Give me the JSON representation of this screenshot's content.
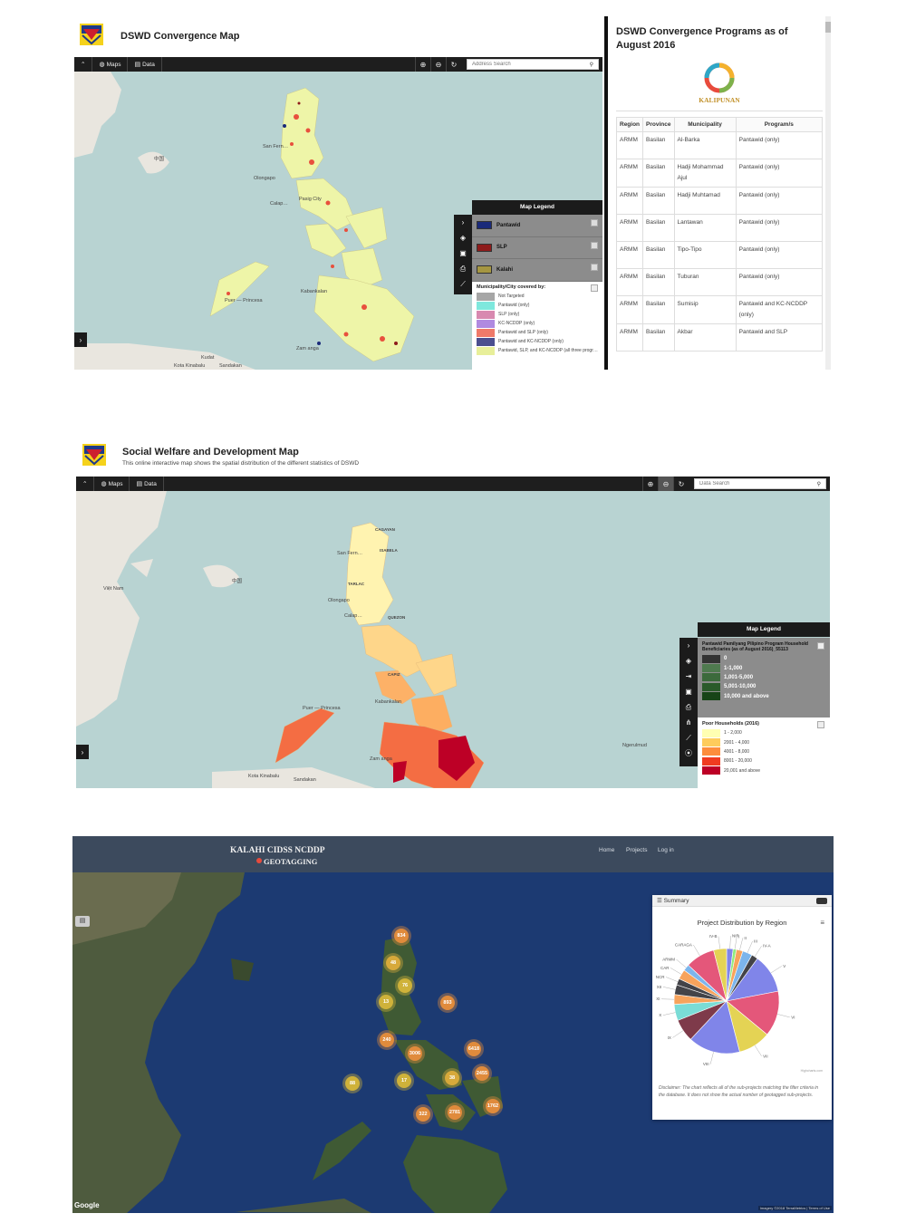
{
  "panel1": {
    "title": "DSWD Convergence Map",
    "toolbar": {
      "maps": "Maps",
      "data": "Data",
      "search_placeholder": "Address Search"
    },
    "map_labels": {
      "china": "中国",
      "san_fernando": "San Fern…",
      "olongapo": "Olongapo",
      "calap": "Calap…",
      "pasig_city": "Pasig City",
      "puerto_princesa": "Puer — Princesa",
      "kabankalan": "Kabankalan",
      "zamboanga": "Zam   anga",
      "kota_kinabalu": "Kota Kinabalu",
      "kudat": "Kudat",
      "sandakan": "Sandakan"
    },
    "legend": {
      "title": "Map Legend",
      "layers": [
        {
          "label": "Pantawid",
          "color": "#1a2a7a"
        },
        {
          "label": "SLP",
          "color": "#8e1b1b"
        },
        {
          "label": "Kalahi",
          "color": "#a59642"
        }
      ],
      "covered_title": "Municipality/City covered by:",
      "covered": [
        {
          "label": "Not Targeted",
          "color": "#a6a6a6"
        },
        {
          "label": "Pantawid (only)",
          "color": "#7ee8dd"
        },
        {
          "label": "SLP (only)",
          "color": "#d889b0"
        },
        {
          "label": "KC-NCDDP (only)",
          "color": "#b08ae0"
        },
        {
          "label": "Pantawid and SLP (only)",
          "color": "#ef7a6a"
        },
        {
          "label": "Pantawid and KC-NCDDP (only)",
          "color": "#4b4f8f"
        },
        {
          "label": "Pantawid, SLP, and KC-NCDDP (all three progr…",
          "color": "#e8ef9a"
        }
      ]
    },
    "programs": {
      "title": "DSWD Convergence Programs as of August 2016",
      "logo_text": "KALIPUNAN",
      "columns": [
        "Region",
        "Province",
        "Municipality",
        "Program/s"
      ],
      "rows": [
        [
          "ARMM",
          "Basilan",
          "Al-Barka",
          "Pantawid (only)"
        ],
        [
          "ARMM",
          "Basilan",
          "Hadji Mohammad Ajul",
          "Pantawid (only)"
        ],
        [
          "ARMM",
          "Basilan",
          "Hadji Muhtamad",
          "Pantawid (only)"
        ],
        [
          "ARMM",
          "Basilan",
          "Lantawan",
          "Pantawid (only)"
        ],
        [
          "ARMM",
          "Basilan",
          "Tipo-Tipo",
          "Pantawid (only)"
        ],
        [
          "ARMM",
          "Basilan",
          "Tuburan",
          "Pantawid (only)"
        ],
        [
          "ARMM",
          "Basilan",
          "Sumisip",
          "Pantawid and KC-NCDDP (only)"
        ],
        [
          "ARMM",
          "Basilan",
          "Akbar",
          "Pantawid and SLP"
        ]
      ]
    }
  },
  "panel2": {
    "title": "Social Welfare and Development Map",
    "subtitle": "This online interactive map shows the spatial distribution of the different statistics of DSWD",
    "toolbar": {
      "maps": "Maps",
      "data": "Data",
      "search_placeholder": "Data Search"
    },
    "map_labels": {
      "china": "中国",
      "viet_nam": "Việt Nam",
      "cagayan": "CAGAYAN",
      "isabela": "ISABELA",
      "tarlac": "TARLAC",
      "quezon": "QUEZON",
      "capiz": "CAPIZ",
      "san_fernando": "San Fern…",
      "olongapo": "Olongapo",
      "calap": "Calap…",
      "puerto_princesa": "Puer — Princesa",
      "kabankalan": "Kabankalan",
      "zamboanga": "Zam   anga",
      "kota_kinabalu": "Kota Kinabalu",
      "sandakan": "Sandakan",
      "ngerulmud": "Ngerulmud"
    },
    "legend": {
      "title": "Map Legend",
      "layer_title": "Pantawid Pamilyang Pilipino Program Household Beneficiaries (as of August 2016)_55113",
      "layer_items": [
        {
          "label": "0",
          "color": "#333333"
        },
        {
          "label": "1-1,000",
          "color": "#4f7a4f"
        },
        {
          "label": "1,001-5,000",
          "color": "#3c6a3c"
        },
        {
          "label": "5,001-10,000",
          "color": "#2a5a2a"
        },
        {
          "label": "10,000 and above",
          "color": "#174417"
        }
      ],
      "poor_title": "Poor Households (2016)",
      "poor_items": [
        {
          "label": "1 - 2,000",
          "color": "#ffffb2"
        },
        {
          "label": "2001 - 4,000",
          "color": "#fecc5c"
        },
        {
          "label": "4001 - 8,000",
          "color": "#fd8d3c"
        },
        {
          "label": "8001 - 20,000",
          "color": "#f03b20"
        },
        {
          "label": "20,001 and above",
          "color": "#bd0026"
        }
      ]
    }
  },
  "panel3": {
    "brand_top": "KALAHI CIDSS NCDDP",
    "brand_bottom": "GEOTAGGING",
    "nav": [
      "Home",
      "Projects",
      "Log in"
    ],
    "google": "Google",
    "footer": "Imagery ©2018 TerraMetrics | Terms of Use",
    "clusters": [
      "834",
      "48",
      "76",
      "13",
      "893",
      "240",
      "3006",
      "6418",
      "17",
      "38",
      "2455",
      "88",
      "1762",
      "322",
      "2781"
    ],
    "summary": {
      "header": "Summary",
      "chart_title": "Project Distribution by Region",
      "credits": "Highcharts.com",
      "disclaimer": "Disclaimer: The chart reflects all of the sub-projects matching the filter criteria in the database. It does not show the actual number of geotagged sub-projects."
    }
  },
  "chart_data": {
    "type": "pie",
    "title": "Project Distribution by Region",
    "categories": [
      "NIR",
      "I",
      "II",
      "III",
      "IV-A",
      "V",
      "VI",
      "VII",
      "VIII",
      "IX",
      "X",
      "XI",
      "XII",
      "NCR",
      "CAR",
      "ARMM",
      "CARAGA",
      "IV-B"
    ],
    "values": [
      2,
      1,
      2,
      3,
      2,
      12,
      14,
      10,
      16,
      7,
      5,
      3,
      3,
      2,
      3,
      2,
      9,
      4
    ],
    "colors": [
      "#8085e9",
      "#90ed7d",
      "#f7a35c",
      "#7cb5ec",
      "#434348",
      "#8085e9",
      "#e4577a",
      "#e4d354",
      "#8085e9",
      "#7e3a4a",
      "#7adcd6",
      "#f7a35c",
      "#434348",
      "#434348",
      "#f7a35c",
      "#7cb5ec",
      "#e4577a",
      "#e4d354"
    ]
  }
}
